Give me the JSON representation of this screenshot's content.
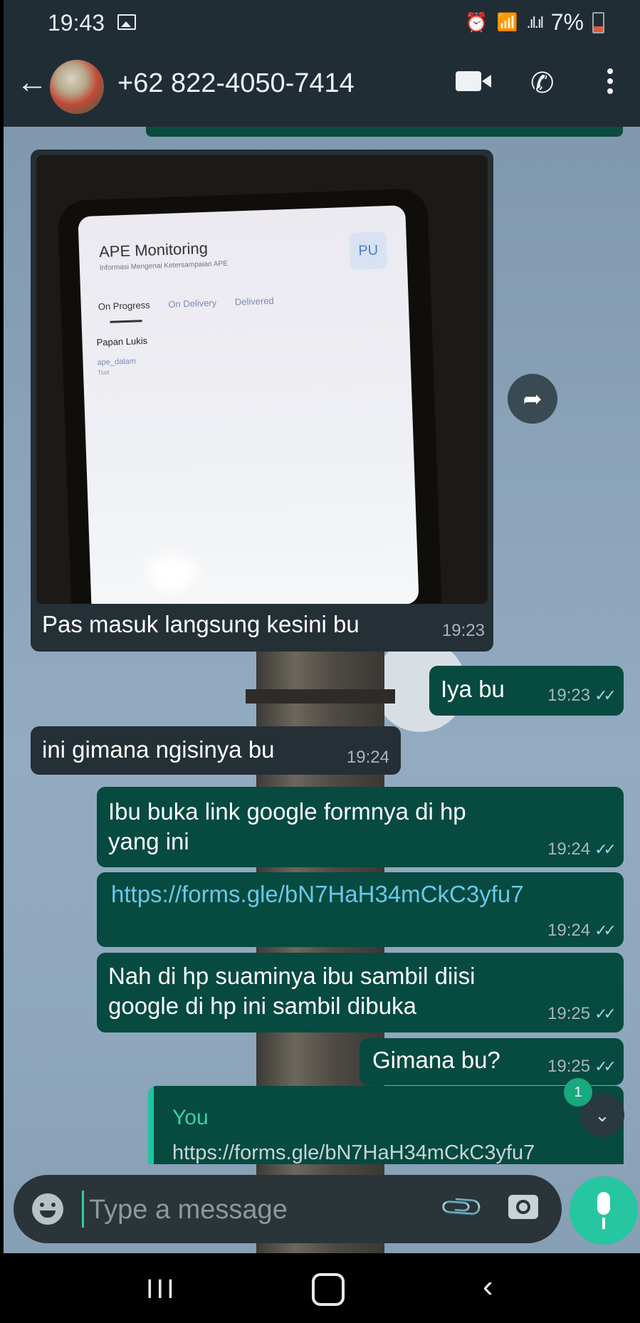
{
  "status_bar": {
    "time": "19:43",
    "battery": "7%",
    "battery_level_percent": 7,
    "icons": [
      "image-icon",
      "alarm-icon",
      "wifi-icon",
      "signal-icon",
      "battery-icon"
    ]
  },
  "header": {
    "contact": "+62 822-4050-7414",
    "icons": [
      "back-arrow-icon",
      "video-call-icon",
      "voice-call-icon",
      "more-options-icon"
    ]
  },
  "image_message": {
    "screen": {
      "title": "APE Monitoring",
      "subtitle": "Informasi Mengenai Ketersampaian APE",
      "badge": "PU",
      "tabs": [
        "On Progress",
        "On Delivery",
        "Delivered"
      ],
      "item": "Papan Lukis",
      "item_sub": "ape_dalam",
      "item_sub2": "Tset"
    },
    "caption": "Pas masuk langsung kesini bu",
    "time": "19:23"
  },
  "messages": [
    {
      "direction": "out",
      "text": "Iya bu",
      "time": "19:23"
    },
    {
      "direction": "in",
      "text": "ini gimana ngisinya bu",
      "time": "19:24"
    },
    {
      "direction": "out",
      "text": "Ibu buka link google formnya di hp yang ini",
      "time": "19:24"
    },
    {
      "direction": "out",
      "text": "https://forms.gle/bN7HaH34mCkC3yfu7",
      "time": "19:24"
    },
    {
      "direction": "out",
      "text": "Nah di hp suaminya ibu sambil diisi google di hp ini sambil dibuka",
      "time": "19:25"
    },
    {
      "direction": "out",
      "text": "Gimana bu?",
      "time": "19:25"
    }
  ],
  "quoted_message": {
    "author": "You",
    "text": "https://forms.gle/bN7HaH34mCkC3yfu7"
  },
  "unread_count": "1",
  "input": {
    "placeholder": "Type a message"
  },
  "colors": {
    "header": "#212d35",
    "incoming_bubble": "#252f36",
    "outgoing_bubble": "#064a40",
    "accent": "#26c6a0",
    "read_ticks": "#9fd4e6"
  }
}
